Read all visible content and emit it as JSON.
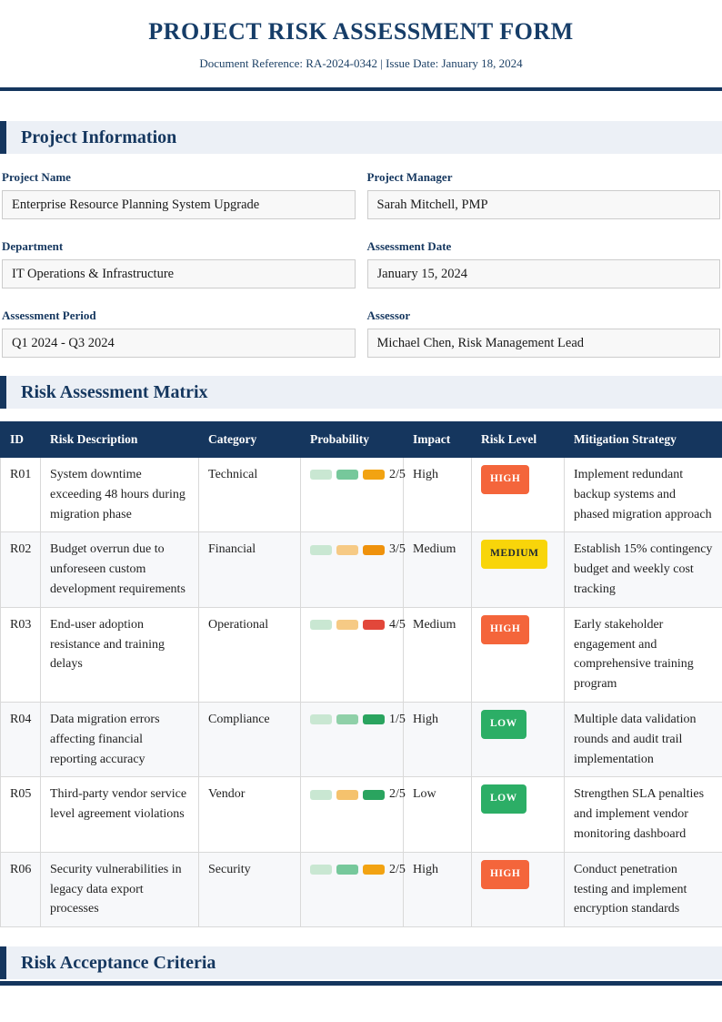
{
  "page": {
    "title": "PROJECT RISK ASSESSMENT FORM",
    "subtitle": "Document Reference: RA-2024-0342 | Issue Date: January 18, 2024"
  },
  "sections": {
    "project_information": {
      "title": "Project Information"
    },
    "risk_matrix": {
      "title": "Risk Assessment Matrix"
    },
    "risk_acceptance": {
      "title": "Risk Acceptance Criteria"
    }
  },
  "form": {
    "fields": [
      {
        "label": "Project Name",
        "value": "Enterprise Resource Planning System Upgrade"
      },
      {
        "label": "Project Manager",
        "value": "Sarah Mitchell, PMP"
      },
      {
        "label": "Department",
        "value": "IT Operations & Infrastructure"
      },
      {
        "label": "Assessment Date",
        "value": "January 15, 2024"
      },
      {
        "label": "Assessment Period",
        "value": "Q1 2024 - Q3 2024"
      },
      {
        "label": "Assessor",
        "value": "Michael Chen, Risk Management Lead"
      }
    ]
  },
  "table": {
    "columns": [
      "ID",
      "Risk Description",
      "Category",
      "Probability",
      "Impact",
      "Risk Level",
      "Mitigation Strategy"
    ],
    "rows": [
      {
        "id": "R01",
        "description": "System downtime exceeding 48 hours during migration phase",
        "category": "Technical",
        "probability": "2/5",
        "pills": [
          "#c9e7d2",
          "#76c89b",
          "#f2a312"
        ],
        "impact": "High",
        "risk": {
          "label": "HIGH",
          "bg": "#f4653b",
          "fg": "#ffffff"
        },
        "mitigation": "Implement redundant backup systems and phased migration approach"
      },
      {
        "id": "R02",
        "description": "Budget overrun due to unforeseen custom development requirements",
        "category": "Financial",
        "probability": "3/5",
        "pills": [
          "#c9e7d2",
          "#f6ca85",
          "#ef920c"
        ],
        "impact": "Medium",
        "risk": {
          "label": "MEDIUM",
          "bg": "#f8d50a",
          "fg": "#1c2733"
        },
        "mitigation": "Establish 15% contingency budget and weekly cost tracking"
      },
      {
        "id": "R03",
        "description": "End-user adoption resistance and training delays",
        "category": "Operational",
        "probability": "4/5",
        "pills": [
          "#c9e7d2",
          "#f6ca85",
          "#e2473a"
        ],
        "impact": "Medium",
        "risk": {
          "label": "HIGH",
          "bg": "#f4653b",
          "fg": "#ffffff"
        },
        "mitigation": "Early stakeholder engagement and comprehensive training program"
      },
      {
        "id": "R04",
        "description": "Data migration errors affecting financial reporting accuracy",
        "category": "Compliance",
        "probability": "1/5",
        "pills": [
          "#c9e7d2",
          "#8fd0a8",
          "#2aa45f"
        ],
        "impact": "High",
        "risk": {
          "label": "LOW",
          "bg": "#2cae66",
          "fg": "#ffffff"
        },
        "mitigation": "Multiple data validation rounds and audit trail implementation"
      },
      {
        "id": "R05",
        "description": "Third-party vendor service level agreement violations",
        "category": "Vendor",
        "probability": "2/5",
        "pills": [
          "#c9e7d2",
          "#f5c26d",
          "#2aa45f"
        ],
        "impact": "Low",
        "risk": {
          "label": "LOW",
          "bg": "#2cae66",
          "fg": "#ffffff"
        },
        "mitigation": "Strengthen SLA penalties and implement vendor monitoring dashboard"
      },
      {
        "id": "R06",
        "description": "Security vulnerabilities in legacy data export processes",
        "category": "Security",
        "probability": "2/5",
        "pills": [
          "#c9e7d2",
          "#76c89b",
          "#f2a312"
        ],
        "impact": "High",
        "risk": {
          "label": "HIGH",
          "bg": "#f4653b",
          "fg": "#ffffff"
        },
        "mitigation": "Conduct penetration testing and implement encryption standards"
      }
    ]
  },
  "colors": {
    "navy": "#15365e",
    "section_bg": "#ecf0f6",
    "high_badge": "#f4653b",
    "medium_badge": "#f8d50a",
    "low_badge": "#2cae66"
  }
}
